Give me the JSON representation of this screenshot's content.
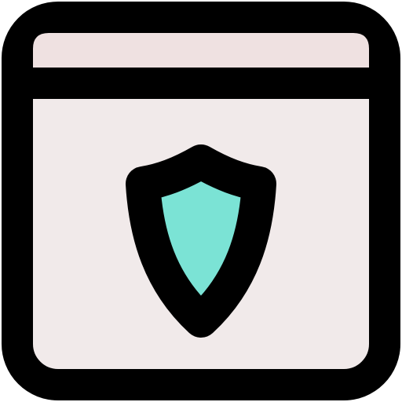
{
  "icon": {
    "name": "browser-window-shield-icon",
    "colors": {
      "outline": "#000000",
      "window_body": "#F1EAEA",
      "title_bar": "#EFE1E1",
      "shield_fill": "#7BE3D5",
      "background": "#FFFFFF"
    }
  }
}
